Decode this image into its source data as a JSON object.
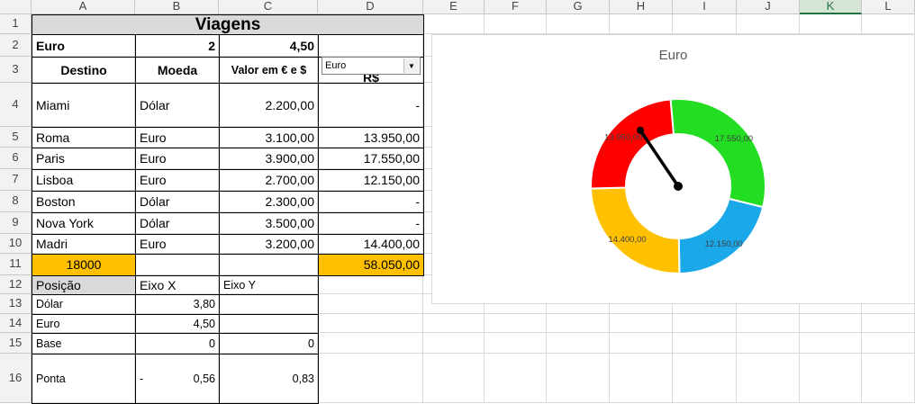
{
  "columns": [
    "A",
    "B",
    "C",
    "D",
    "E",
    "F",
    "G",
    "H",
    "I",
    "J",
    "K",
    "L"
  ],
  "selected_column": "K",
  "rows": [
    "1",
    "2",
    "3",
    "4",
    "5",
    "6",
    "7",
    "8",
    "9",
    "10",
    "11",
    "12",
    "13",
    "14",
    "15",
    "16"
  ],
  "title": "Viagens",
  "row2": {
    "label": "Euro",
    "b": "2",
    "c": "4,50"
  },
  "dropdown": {
    "value": "Euro"
  },
  "headers": {
    "destino": "Destino",
    "moeda": "Moeda",
    "valor": "Valor em € e $",
    "converter": "Converter para R$"
  },
  "trips": [
    {
      "dest": "Miami",
      "cur": "Dólar",
      "val": "2.200,00",
      "conv": "-"
    },
    {
      "dest": "Roma",
      "cur": "Euro",
      "val": "3.100,00",
      "conv": "13.950,00"
    },
    {
      "dest": "Paris",
      "cur": "Euro",
      "val": "3.900,00",
      "conv": "17.550,00"
    },
    {
      "dest": "Lisboa",
      "cur": "Euro",
      "val": "2.700,00",
      "conv": "12.150,00"
    },
    {
      "dest": "Boston",
      "cur": "Dólar",
      "val": "2.300,00",
      "conv": "-"
    },
    {
      "dest": "Nova York",
      "cur": "Dólar",
      "val": "3.500,00",
      "conv": "-"
    },
    {
      "dest": "Madri",
      "cur": "Euro",
      "val": "3.200,00",
      "conv": "14.400,00"
    }
  ],
  "row11": {
    "a": "18000",
    "d": "58.050,00"
  },
  "pos_header": {
    "a": "Posição",
    "b": "Eixo X",
    "c": "Eixo Y"
  },
  "pos_rows": [
    {
      "label": "Dólar",
      "x": "3,80",
      "y": ""
    },
    {
      "label": "Euro",
      "x": "4,50",
      "y": ""
    },
    {
      "label": "Base",
      "x": "0",
      "y": "0"
    },
    {
      "label": "Ponta",
      "x_prefix": "-",
      "x": "0,56",
      "y": "0,83"
    }
  ],
  "chart_data": {
    "type": "pie",
    "variant": "doughnut gauge with needle",
    "title": "Euro",
    "slices": [
      {
        "label": "17.550,00",
        "value": 17550,
        "color": "#22dd22"
      },
      {
        "label": "12.150,00",
        "value": 12150,
        "color": "#1aa8e8"
      },
      {
        "label": "14.400,00",
        "value": 14400,
        "color": "#ffc000"
      },
      {
        "label": "-",
        "value": 0,
        "color": "#ffc000"
      },
      {
        "label": "13.950,00",
        "value": 13950,
        "color": "#ff0000"
      }
    ],
    "needle": {
      "x": -0.56,
      "y": 0.83,
      "color": "#000000"
    }
  }
}
